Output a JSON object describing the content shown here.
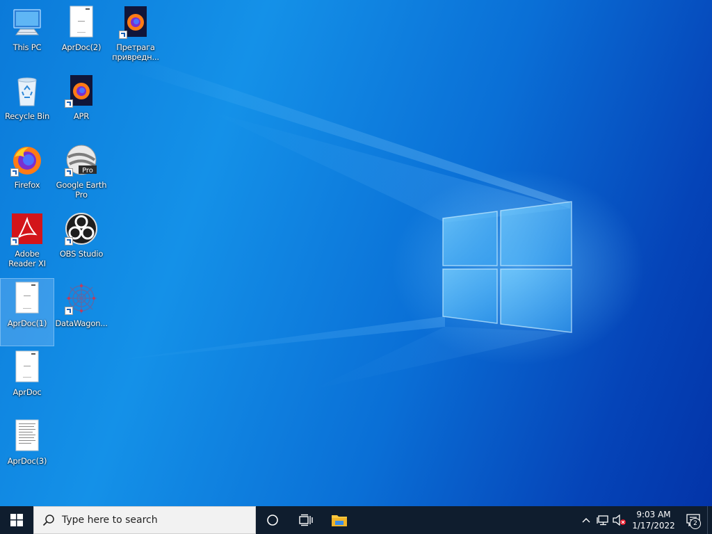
{
  "desktop": {
    "icons": [
      {
        "label": "This PC",
        "icon": "this-pc-icon"
      },
      {
        "label": "Recycle Bin",
        "icon": "recycle-bin-icon"
      },
      {
        "label": "Firefox",
        "icon": "firefox-icon"
      },
      {
        "label": "Adobe Reader XI",
        "icon": "adobe-reader-icon"
      },
      {
        "label": "AprDoc(1)",
        "icon": "document-icon"
      },
      {
        "label": "AprDoc",
        "icon": "document-icon"
      },
      {
        "label": "AprDoc(3)",
        "icon": "document-icon"
      },
      {
        "label": "AprDoc(2)",
        "icon": "document-icon"
      },
      {
        "label": "APR",
        "icon": "firefox-dark-icon"
      },
      {
        "label": "Google Earth Pro",
        "icon": "google-earth-icon",
        "badge": "Pro"
      },
      {
        "label": "OBS Studio",
        "icon": "obs-icon"
      },
      {
        "label": "DataWagon...",
        "icon": "datawagon-icon"
      },
      {
        "label": "Претрага привредн...",
        "icon": "firefox-dark-icon"
      }
    ]
  },
  "taskbar": {
    "search_placeholder": "Type here to search",
    "time": "9:03 AM",
    "date": "1/17/2022",
    "notification_count": "2"
  },
  "colors": {
    "taskbar": "#0f1d2e",
    "desktop_blue": "#0b7ad9"
  }
}
